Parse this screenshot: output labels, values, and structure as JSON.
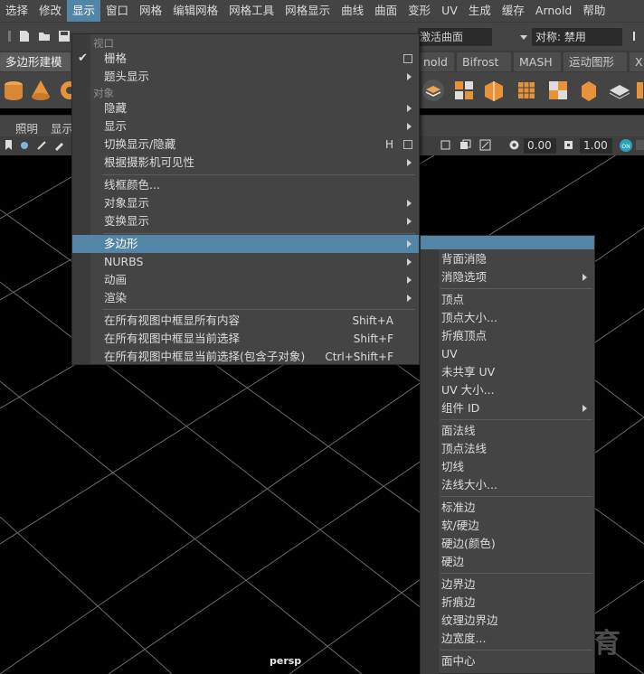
{
  "menubar": {
    "items": [
      "选择",
      "修改",
      "显示",
      "窗口",
      "网格",
      "编辑网格",
      "网格工具",
      "网格显示",
      "曲线",
      "曲面",
      "变形",
      "UV",
      "生成",
      "缓存",
      "Arnold",
      "帮助"
    ],
    "active_index": 2
  },
  "statusline": {
    "input_field_value": "激活曲面",
    "symmetry_value": "对称: 禁用"
  },
  "shelf_tabs": {
    "items": [
      "多边形建模",
      "nold",
      "Bifrost",
      "MASH",
      "运动图形",
      "X"
    ]
  },
  "panel_menu": {
    "items": [
      "照明",
      "显示"
    ]
  },
  "panel_toolbar": {
    "field_a": "0.00",
    "field_b": "1.00"
  },
  "display_menu": {
    "section_viewport": "视口",
    "grid": "栅格",
    "heads_up": "题头显示",
    "section_object": "对象",
    "hide": "隐藏",
    "show": "显示",
    "toggle_show_hide": "切换显示/隐藏",
    "toggle_shortcut": "H",
    "camera_visibility": "根据摄影机可见性",
    "wireframe_color": "线框颜色...",
    "object_display": "对象显示",
    "transform_display": "变换显示",
    "polygon": "多边形",
    "nurbs": "NURBS",
    "animation": "动画",
    "render": "渲染",
    "frame_all": "在所有视图中框显所有内容",
    "frame_all_shortcut": "Shift+A",
    "frame_selection": "在所有视图中框显当前选择",
    "frame_selection_shortcut": "Shift+F",
    "frame_selection_children": "在所有视图中框显当前选择(包含子对象)",
    "frame_selection_children_shortcut": "Ctrl+Shift+F"
  },
  "polygon_submenu": {
    "items": [
      "背面消隐",
      "消隐选项",
      "顶点",
      "顶点大小...",
      "折痕顶点",
      "UV",
      "未共享 UV",
      "UV 大小...",
      "组件 ID",
      "面法线",
      "顶点法线",
      "切线",
      "法线大小...",
      "标准边",
      "软/硬边",
      "硬边(颜色)",
      "硬边",
      "边界边",
      "折痕边",
      "纹理边界边",
      "边宽度...",
      "面中心"
    ]
  },
  "viewport": {
    "camera_label": "persp",
    "watermark": "最需教育"
  },
  "colors": {
    "highlight": "#5285a6",
    "menu_bg": "#444444",
    "shelf_orange": "#e8923a",
    "grid_line": "#6b6b6b"
  }
}
